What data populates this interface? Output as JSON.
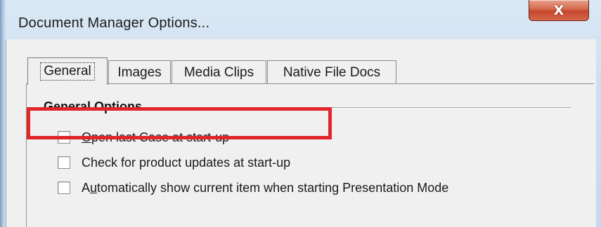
{
  "dialog": {
    "title": "Document Manager Options...",
    "close_glyph": "X"
  },
  "tabs": [
    {
      "label": "General",
      "active": true
    },
    {
      "label": "Images",
      "active": false
    },
    {
      "label": "Media Clips",
      "active": false
    },
    {
      "label": "Native File Docs",
      "active": false
    }
  ],
  "general_options": {
    "group_title": "General Options",
    "options": [
      {
        "label_before": "",
        "accel": "O",
        "label_after": "pen last Case at start-up",
        "checked": false
      },
      {
        "label_before": "",
        "accel": "",
        "label_after": "Check for product updates at start-up",
        "checked": false
      },
      {
        "label_before": "A",
        "accel": "u",
        "label_after": "tomatically show current item when starting Presentation Mode",
        "checked": false
      }
    ]
  },
  "colors": {
    "highlight": "#e0262b",
    "close_button": "#c6472b"
  }
}
